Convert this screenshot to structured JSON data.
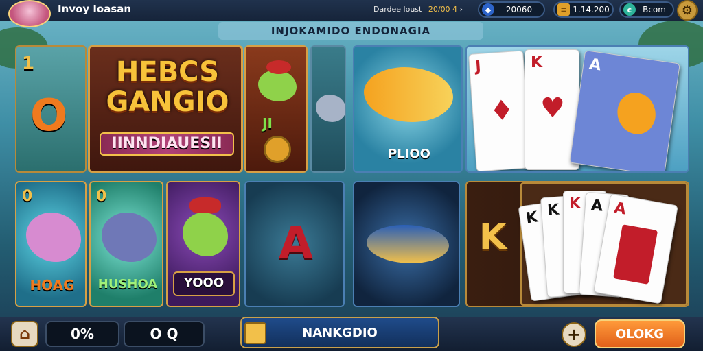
{
  "header": {
    "app_title": "Invoy Ioasan",
    "stat_text": "Dardee loust",
    "stat_value": "20/00 4",
    "currency_1": "20060",
    "currency_2": "1.14.200",
    "currency_3": "Bcom"
  },
  "banner": {
    "title": "INJOKAMIDO ENDONAGIA"
  },
  "tiles": {
    "left_level": "1",
    "left_logo": "O",
    "featured_title": "HEBCS GANGIO",
    "featured_subtitle": "IINNDIAUESII",
    "small_badge": "JI",
    "pliqo_label": "PLIOO",
    "hoag_badge": "0",
    "hoag_label": "HOAG",
    "hushoa_badge": "0",
    "hushoa_label": "HUSHOA",
    "yoqo_label": "YOOO",
    "ace_letter": "A",
    "king_letter": "K"
  },
  "cards_top": [
    "J",
    "K",
    "A"
  ],
  "cards_bottom": [
    "K",
    "K",
    "K",
    "A",
    "A"
  ],
  "bottom": {
    "field_1": "0%",
    "field_2": "O Q",
    "search_value": "NANKGDIO",
    "action_label": "OLOKG"
  },
  "colors": {
    "accent_orange": "#f07a1e",
    "gold": "#f2c04a",
    "panel_blue": "#1d3c6e"
  }
}
